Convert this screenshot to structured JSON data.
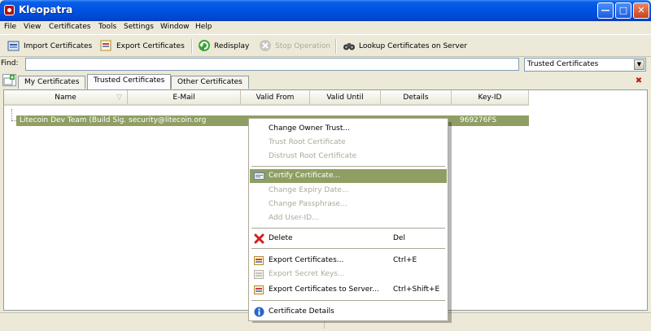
{
  "window": {
    "title": "Kleopatra"
  },
  "menubar": [
    "File",
    "View",
    "Certificates",
    "Tools",
    "Settings",
    "Window",
    "Help"
  ],
  "toolbar": {
    "import": "Import Certificates",
    "export": "Export Certificates",
    "redisplay": "Redisplay",
    "stop": "Stop Operation",
    "lookup": "Lookup Certificates on Server"
  },
  "find": {
    "label": "Find:",
    "value": "",
    "filter": "Trusted Certificates"
  },
  "tabs": [
    "My Certificates",
    "Trusted Certificates",
    "Other Certificates"
  ],
  "table": {
    "columns": [
      "Name",
      "E-Mail",
      "Valid From",
      "Valid Until",
      "Details",
      "Key-ID"
    ],
    "rows": [
      {
        "name": "Litecoin Dev Team (Build Sig...",
        "email": "security@litecoin.org",
        "key_id": "969276FS"
      }
    ]
  },
  "context_menu": {
    "items": [
      {
        "label": "Change Owner Trust...",
        "shortcut": ""
      },
      {
        "label": "Trust Root Certificate",
        "shortcut": ""
      },
      {
        "label": "Distrust Root Certificate",
        "shortcut": ""
      },
      {
        "label": "Certify Certificate...",
        "shortcut": ""
      },
      {
        "label": "Change Expiry Date...",
        "shortcut": ""
      },
      {
        "label": "Change Passphrase...",
        "shortcut": ""
      },
      {
        "label": "Add User-ID...",
        "shortcut": ""
      },
      {
        "label": "Delete",
        "shortcut": "Del"
      },
      {
        "label": "Export Certificates...",
        "shortcut": "Ctrl+E"
      },
      {
        "label": "Export Secret Keys...",
        "shortcut": ""
      },
      {
        "label": "Export Certificates to Server...",
        "shortcut": "Ctrl+Shift+E"
      },
      {
        "label": "Certificate Details",
        "shortcut": ""
      }
    ]
  },
  "colors": {
    "title_bar": "#0054e3",
    "selection": "#8f9f64",
    "window_bg": "#ece9d8"
  }
}
